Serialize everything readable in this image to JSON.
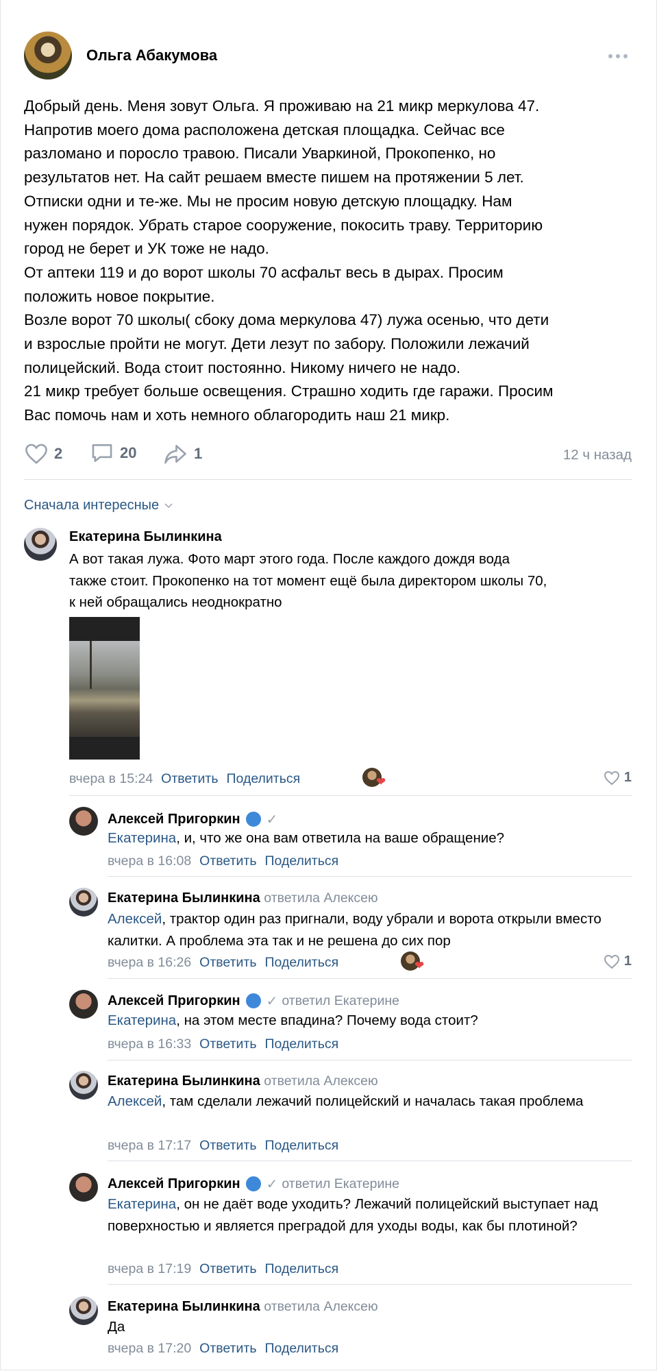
{
  "post": {
    "author": "Ольга Абакумова",
    "menu_icon": "more-horizontal-icon",
    "text": "Добрый день. Меня зовут Ольга. Я проживаю на 21 микр меркулова 47.\nНапротив моего дома расположена детская площадка. Сейчас все\nразломано и поросло травою. Писали Уваркиной, Прокопенко, но\nрезультатов нет. На сайт решаем вместе пишем на протяжении 5 лет.\nОтписки одни и те-же. Мы не просим новую детскую площадку. Нам\nнужен порядок. Убрать старое сооружение, покосить траву. Территорию\nгород не берет и УК тоже не надо.\nОт аптеки 119 и до ворот школы 70 асфальт весь в дырах. Просим\nположить новое покрытие.\nВозле ворот 70 школы( сбоку дома меркулова 47) лужа осенью, что дети\nи взрослые пройти не могут. Дети лезут по забору. Положили лежачий\nполицейский. Вода стоит постоянно. Никому ничего не надо.\n21 микр требует больше освещения. Страшно ходить где гаражи. Просим\nВас помочь нам и хоть немного облагородить наш 21 микр.",
    "likes": "2",
    "comments": "20",
    "shares": "1",
    "time": "12 ч назад"
  },
  "sort_label": "Сначала интересные",
  "comment_main": {
    "author": "Екатерина Былинкина",
    "text": "А вот такая лужа. Фото март этого года. После каждого дождя вода\nтакже стоит. Прокопенко на тот момент ещё была директором школы 70,\nк ней обращались неоднократно",
    "time": "вчера в 15:24",
    "reply": "Ответить",
    "share": "Поделиться",
    "likes": "1"
  },
  "replies": [
    {
      "author": "Алексей Пригоркин",
      "suffix": "",
      "mention": "Екатерина",
      "text": ", и, что же она вам ответила на ваше обращение?",
      "time": "вчера в 16:08",
      "reply": "Ответить",
      "share": "Поделиться",
      "likes": ""
    },
    {
      "author": "Екатерина Былинкина",
      "suffix": "ответила Алексею",
      "mention": "Алексей",
      "text": ", трактор один раз пригнали, воду убрали и ворота открыли вместо калитки. А проблема эта так и не решена до сих пор",
      "time": "вчера в 16:26",
      "reply": "Ответить",
      "share": "Поделиться",
      "likes": "1"
    },
    {
      "author": "Алексей Пригоркин",
      "suffix": "ответил Екатерине",
      "mention": "Екатерина",
      "text": ", на этом месте впадина? Почему вода стоит?",
      "time": "вчера в 16:33",
      "reply": "Ответить",
      "share": "Поделиться",
      "likes": ""
    },
    {
      "author": "Екатерина Былинкина",
      "suffix": "ответила Алексею",
      "mention": "Алексей",
      "text": ", там сделали лежачий полицейский и началась такая проблема",
      "time": "вчера в 17:17",
      "reply": "Ответить",
      "share": "Поделиться",
      "likes": ""
    },
    {
      "author": "Алексей Пригоркин",
      "suffix": "ответил Екатерине",
      "mention": "Екатерина",
      "text": ", он не даёт воде уходить? Лежачий полицейский выступает над поверхностью и является преградой для уходы воды, как бы плотиной?",
      "time": "вчера в 17:19",
      "reply": "Ответить",
      "share": "Поделиться",
      "likes": ""
    },
    {
      "author": "Екатерина Былинкина",
      "suffix": "ответила Алексею",
      "mention": "",
      "text": "Да",
      "time": "вчера в 17:20",
      "reply": "Ответить",
      "share": "Поделиться",
      "likes": ""
    }
  ],
  "colors": {
    "link": "#2a5885",
    "muted": "#818c99",
    "separator": "#dce1e6",
    "heart": "#e64646"
  }
}
